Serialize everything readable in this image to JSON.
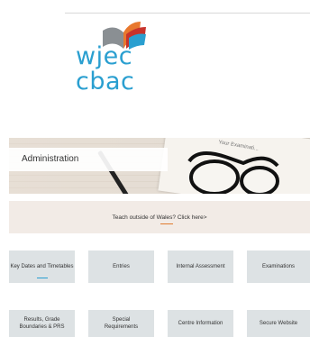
{
  "logo": {
    "line1": "wjec",
    "line2": "cbac",
    "colors": {
      "text": "#2a9fd0",
      "grey": "#8a8f93",
      "orange": "#e8782e",
      "red": "#c8332b",
      "blue": "#2a9fd0"
    }
  },
  "hero": {
    "title": "Administration",
    "paper_text": "Your Examinati..."
  },
  "notice": {
    "text": "Teach outside of Wales? Click here>"
  },
  "tiles": {
    "row1": [
      {
        "label": "Key Dates and Timetables"
      },
      {
        "label": "Entries"
      },
      {
        "label": "Internal Assessment"
      },
      {
        "label": "Examinations"
      }
    ],
    "row2": [
      {
        "label": "Results, Grade Boundaries & PRS"
      },
      {
        "label": "Special Requirements"
      },
      {
        "label": "Centre Information"
      },
      {
        "label": "Secure Website"
      }
    ]
  }
}
